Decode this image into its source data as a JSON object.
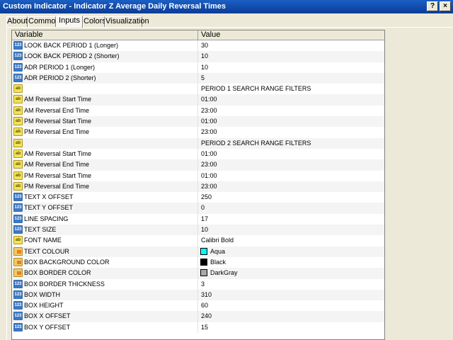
{
  "window": {
    "title": "Custom Indicator - Indicator Z Average Daily Reversal Times",
    "help": "?",
    "close": "×"
  },
  "tabs": [
    {
      "label": "About"
    },
    {
      "label": "Common"
    },
    {
      "label": "Inputs"
    },
    {
      "label": "Colors"
    },
    {
      "label": "Visualization"
    }
  ],
  "grid": {
    "col_variable": "Variable",
    "col_value": "Value",
    "rows": [
      {
        "type": "num",
        "name": "LOOK BACK PERIOD 1 (Longer)",
        "value": "30"
      },
      {
        "type": "num",
        "name": "LOOK BACK PERIOD 2 (Shorter)",
        "value": "10"
      },
      {
        "type": "num",
        "name": "ADR PERIOD 1 (Longer)",
        "value": "10"
      },
      {
        "type": "num",
        "name": "ADR PERIOD 2 (Shorter)",
        "value": "5"
      },
      {
        "type": "str",
        "name": "",
        "value": "PERIOD 1 SEARCH RANGE FILTERS"
      },
      {
        "type": "str",
        "name": "AM Reversal Start Time",
        "value": "01:00"
      },
      {
        "type": "str",
        "name": "AM Reversal End Time",
        "value": "23:00"
      },
      {
        "type": "str",
        "name": "PM Reversal Start Time",
        "value": "01:00"
      },
      {
        "type": "str",
        "name": "PM Reversal End Time",
        "value": "23:00"
      },
      {
        "type": "str",
        "name": "",
        "value": "PERIOD 2 SEARCH RANGE FILTERS"
      },
      {
        "type": "str",
        "name": "AM Reversal Start Time",
        "value": "01:00"
      },
      {
        "type": "str",
        "name": "AM Reversal End Time",
        "value": "23:00"
      },
      {
        "type": "str",
        "name": "PM Reversal Start Time",
        "value": "01:00"
      },
      {
        "type": "str",
        "name": "PM Reversal End Time",
        "value": "23:00"
      },
      {
        "type": "num",
        "name": "TEXT X OFFSET",
        "value": "250"
      },
      {
        "type": "num",
        "name": "TEXT Y OFFSET",
        "value": "0"
      },
      {
        "type": "num",
        "name": "LINE SPACING",
        "value": "17"
      },
      {
        "type": "num",
        "name": "TEXT SIZE",
        "value": "10"
      },
      {
        "type": "str",
        "name": "FONT NAME",
        "value": "Calibri Bold"
      },
      {
        "type": "color",
        "name": "TEXT COLOUR",
        "value": "Aqua",
        "swatch": "#00ffff"
      },
      {
        "type": "color",
        "name": "BOX BACKGROUND COLOR",
        "value": "Black",
        "swatch": "#000000"
      },
      {
        "type": "color",
        "name": "BOX BORDER COLOR",
        "value": "DarkGray",
        "swatch": "#a9a9a9"
      },
      {
        "type": "num",
        "name": "BOX BORDER THICKNESS",
        "value": "3"
      },
      {
        "type": "num",
        "name": "BOX WIDTH",
        "value": "310"
      },
      {
        "type": "num",
        "name": "BOX HEIGHT",
        "value": "60"
      },
      {
        "type": "num",
        "name": "BOX X OFFSET",
        "value": "240"
      },
      {
        "type": "num",
        "name": "BOX Y OFFSET",
        "value": "15"
      }
    ]
  }
}
